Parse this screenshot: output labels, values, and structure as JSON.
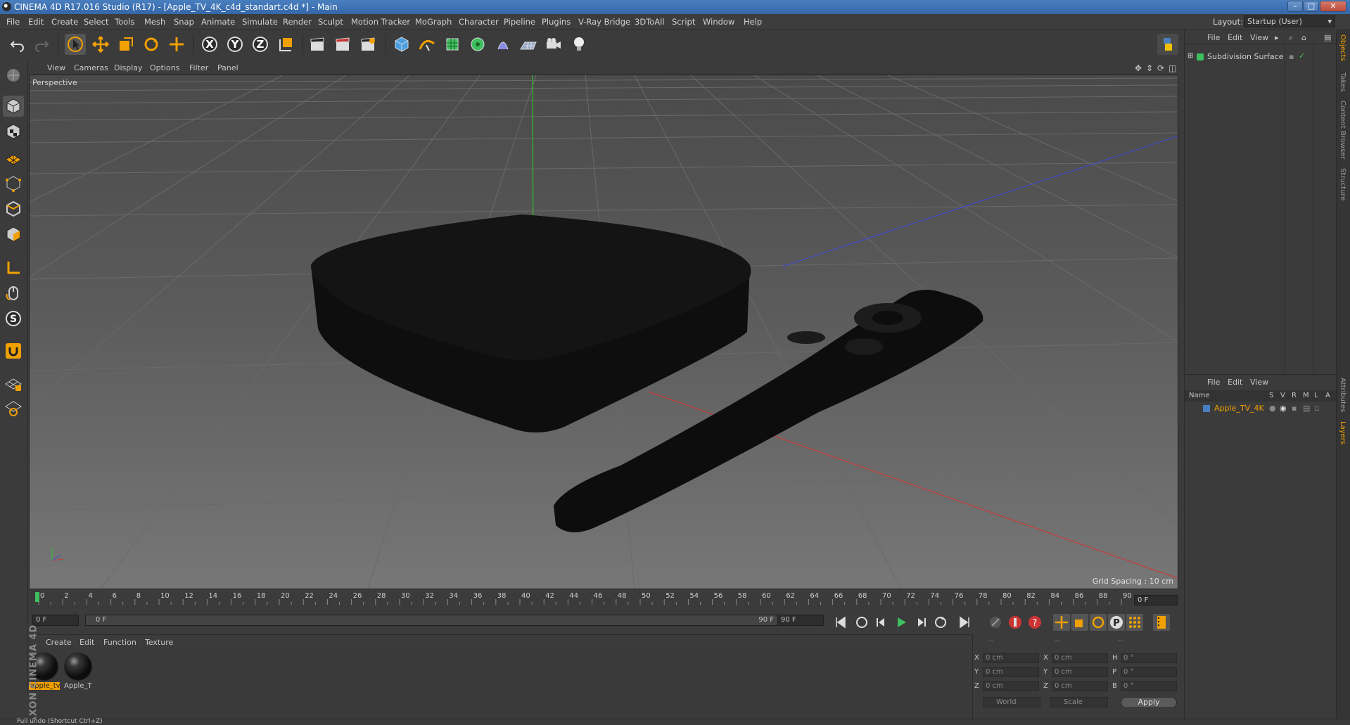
{
  "window": {
    "title": "CINEMA 4D R17.016 Studio (R17) - [Apple_TV_4K_c4d_standart.c4d *] - Main",
    "controls": [
      "–",
      "□",
      "✕"
    ]
  },
  "menubar": {
    "items": [
      "File",
      "Edit",
      "Create",
      "Select",
      "Tools",
      "Mesh",
      "Snap",
      "Animate",
      "Simulate",
      "Render",
      "Sculpt",
      "Motion Tracker",
      "MoGraph",
      "Character",
      "Pipeline",
      "Plugins",
      "V-Ray Bridge",
      "3DToAll",
      "Script",
      "Window",
      "Help"
    ],
    "layout_label": "Layout:",
    "layout_value": "Startup (User)"
  },
  "toolbar": {
    "axis_x": "X",
    "axis_y": "Y",
    "axis_z": "Z"
  },
  "viewport": {
    "menu": [
      "View",
      "Cameras",
      "Display",
      "Options",
      "Filter",
      "Panel"
    ],
    "label": "Perspective",
    "grid_spacing": "Grid Spacing : 10 cm"
  },
  "timeline": {
    "ticks": [
      "0",
      "2",
      "4",
      "6",
      "8",
      "10",
      "12",
      "14",
      "16",
      "18",
      "20",
      "22",
      "24",
      "26",
      "28",
      "30",
      "32",
      "34",
      "36",
      "38",
      "40",
      "42",
      "44",
      "46",
      "48",
      "50",
      "52",
      "54",
      "56",
      "58",
      "60",
      "62",
      "64",
      "66",
      "68",
      "70",
      "72",
      "74",
      "76",
      "78",
      "80",
      "82",
      "84",
      "86",
      "88",
      "90"
    ],
    "current_frame": "0 F"
  },
  "playback": {
    "start_field": "0 F",
    "range_start": "0 F",
    "range_end": "90 F",
    "end_field": "90 F"
  },
  "materials": {
    "menu": [
      "Create",
      "Edit",
      "Function",
      "Texture"
    ],
    "items": [
      {
        "label": "apple_tv",
        "selected": true
      },
      {
        "label": "Apple_T",
        "selected": false
      }
    ]
  },
  "coords": {
    "header": [
      "--",
      "--",
      "--"
    ],
    "rows": [
      {
        "axis": "X",
        "pos": "0 cm",
        "axis2": "X",
        "size": "0 cm",
        "rot_label": "H",
        "rot": "0 °"
      },
      {
        "axis": "Y",
        "pos": "0 cm",
        "axis2": "Y",
        "size": "0 cm",
        "rot_label": "P",
        "rot": "0 °"
      },
      {
        "axis": "Z",
        "pos": "0 cm",
        "axis2": "Z",
        "size": "0 cm",
        "rot_label": "B",
        "rot": "0 °"
      }
    ],
    "world_dropdown": "World",
    "scale_dropdown": "Scale",
    "apply_label": "Apply"
  },
  "objects_panel": {
    "menu": [
      "File",
      "Edit",
      "View"
    ],
    "object_name": "Subdivision Surface"
  },
  "layers_panel": {
    "menu": [
      "File",
      "Edit",
      "View"
    ],
    "columns": [
      "Name",
      "S",
      "V",
      "R",
      "M",
      "L",
      "A"
    ],
    "layer_name": "Apple_TV_4K"
  },
  "side_tabs": [
    "Objects",
    "Takes",
    "Content Browser",
    "Structure",
    "Attributes",
    "Layers"
  ],
  "status": {
    "text": "Full undo (Shortcut Ctrl+Z)"
  },
  "brand": "MAXON CINEMA 4D",
  "colors": {
    "accent": "#f0a000",
    "x_axis": "#c83c3c",
    "y_axis": "#2fbf2f",
    "z_axis": "#3c4cc8"
  }
}
